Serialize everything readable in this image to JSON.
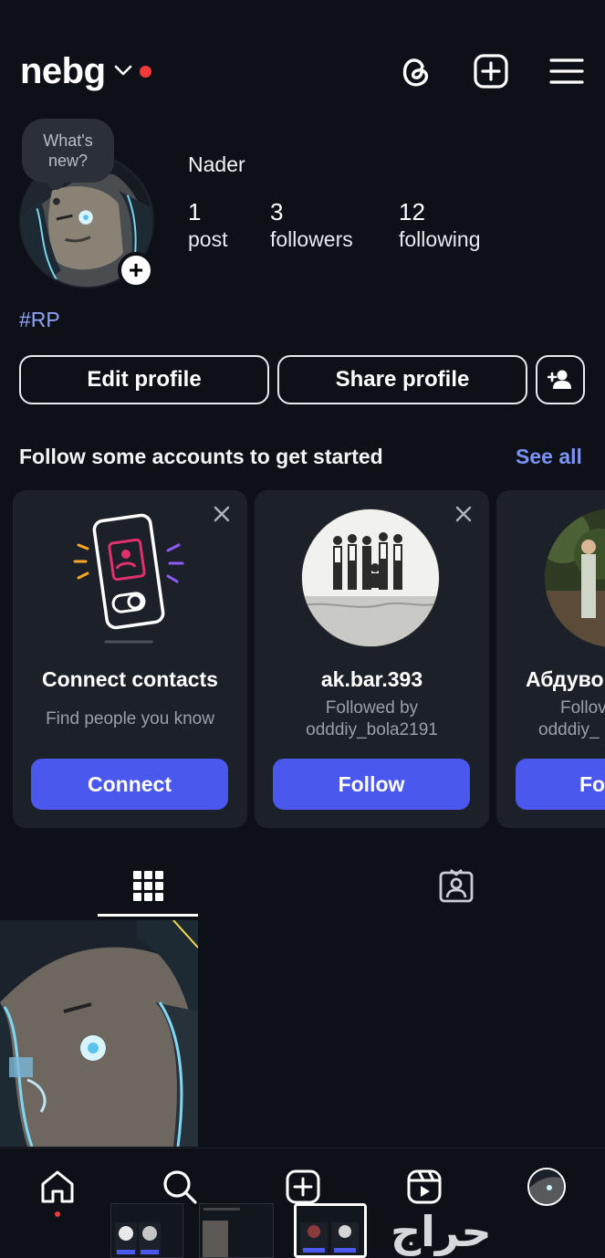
{
  "header": {
    "username": "nebg",
    "icons": [
      "threads-icon",
      "create-post-icon",
      "menu-icon"
    ]
  },
  "profile": {
    "story_bubble": "What's new?",
    "name": "Nader",
    "stats": [
      {
        "value": "1",
        "label": "post"
      },
      {
        "value": "3",
        "label": "followers"
      },
      {
        "value": "12",
        "label": "following"
      }
    ],
    "bio": "#RP",
    "buttons": {
      "edit": "Edit profile",
      "share": "Share profile"
    }
  },
  "suggestions": {
    "title": "Follow some accounts to get started",
    "see_all": "See all",
    "cards": [
      {
        "title": "Connect contacts",
        "subtitle": "Find people you know",
        "button": "Connect"
      },
      {
        "title": "ak.bar.393",
        "subtitle_line1": "Followed by",
        "subtitle_line2": "odddiy_bola2191",
        "button": "Follow"
      },
      {
        "title": "Абдуво",
        "subtitle_line1": "Follov",
        "subtitle_line2": "odddiy_",
        "button": "Fo"
      }
    ]
  },
  "tabs": [
    "posts-grid",
    "tagged"
  ],
  "bottom_nav": [
    "home",
    "search",
    "create",
    "reels",
    "profile"
  ],
  "watermark": "حراج",
  "colors": {
    "background": "#0d1017",
    "card": "#1b2029",
    "accent": "#4b58ee",
    "link": "#7b92f7",
    "live": "#f23a3a"
  }
}
